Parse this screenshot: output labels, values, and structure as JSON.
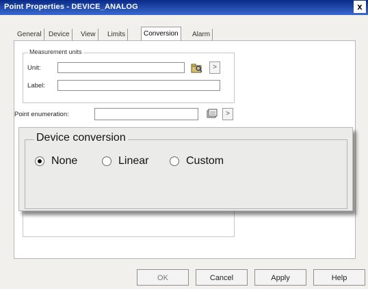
{
  "window": {
    "title": "Point Properties - DEVICE_ANALOG",
    "close_label": "x"
  },
  "tabs": [
    {
      "label": "General"
    },
    {
      "label": "Device"
    },
    {
      "label": "View"
    },
    {
      "label": "Limits"
    },
    {
      "label": "Conversion",
      "active": true
    },
    {
      "label": "Alarm"
    }
  ],
  "measurement_units": {
    "group_label": "Measurement units",
    "unit_label": "Unit:",
    "unit_value": "",
    "label_label": "Label:",
    "label_value": "",
    "browse_icon": "folder-lookup-icon",
    "more_label": ">"
  },
  "point_enumeration": {
    "label": "Point enumeration:",
    "value": "",
    "browse_icon": "stack-icon",
    "more_label": ">"
  },
  "device_conversion": {
    "group_label": "Device conversion",
    "options": [
      {
        "label": "None",
        "selected": true
      },
      {
        "label": "Linear",
        "selected": false
      },
      {
        "label": "Custom",
        "selected": false
      }
    ]
  },
  "buttons": {
    "ok": "OK",
    "cancel": "Cancel",
    "apply": "Apply",
    "help": "Help"
  },
  "colors": {
    "titlebar": "#0a2a88",
    "panel_bg": "#ebebea",
    "dialog_bg": "#f2f0ec"
  }
}
